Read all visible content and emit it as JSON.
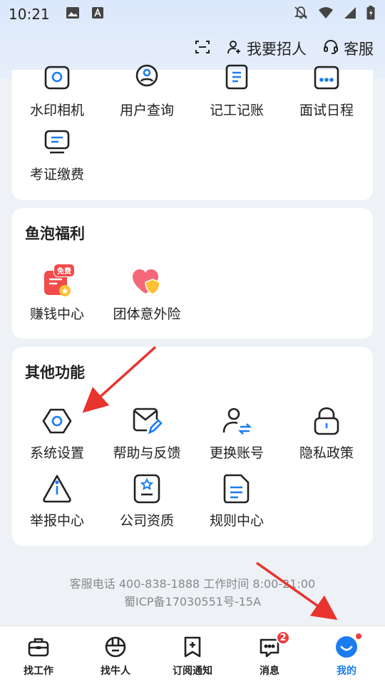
{
  "status_bar": {
    "time": "10:21"
  },
  "header": {
    "scan_icon": "scan-icon",
    "recruit_label": "我要招人",
    "service_label": "客服"
  },
  "tools": {
    "items": [
      {
        "label": "水印相机",
        "icon": "camera-icon"
      },
      {
        "label": "用户查询",
        "icon": "user-search-icon"
      },
      {
        "label": "记工记账",
        "icon": "ledger-icon"
      },
      {
        "label": "面试日程",
        "icon": "calendar-icon"
      },
      {
        "label": "考证缴费",
        "icon": "exam-fee-icon"
      }
    ]
  },
  "welfare": {
    "title": "鱼泡福利",
    "items": [
      {
        "label": "赚钱中心",
        "badge": "免费"
      },
      {
        "label": "团体意外险"
      }
    ]
  },
  "other": {
    "title": "其他功能",
    "items": [
      {
        "label": "系统设置"
      },
      {
        "label": "帮助与反馈"
      },
      {
        "label": "更换账号"
      },
      {
        "label": "隐私政策"
      },
      {
        "label": "举报中心"
      },
      {
        "label": "公司资质"
      },
      {
        "label": "规则中心"
      }
    ]
  },
  "footer": {
    "service_line": "客服电话 400-838-1888 工作时间 8:00-21:00",
    "icp": "蜀ICP备17030551号-15A"
  },
  "tabbar": {
    "tabs": [
      {
        "label": "找工作"
      },
      {
        "label": "找牛人"
      },
      {
        "label": "订阅通知"
      },
      {
        "label": "消息",
        "badge": "2"
      },
      {
        "label": "我的"
      }
    ],
    "active_color": "#1b7cf0"
  }
}
